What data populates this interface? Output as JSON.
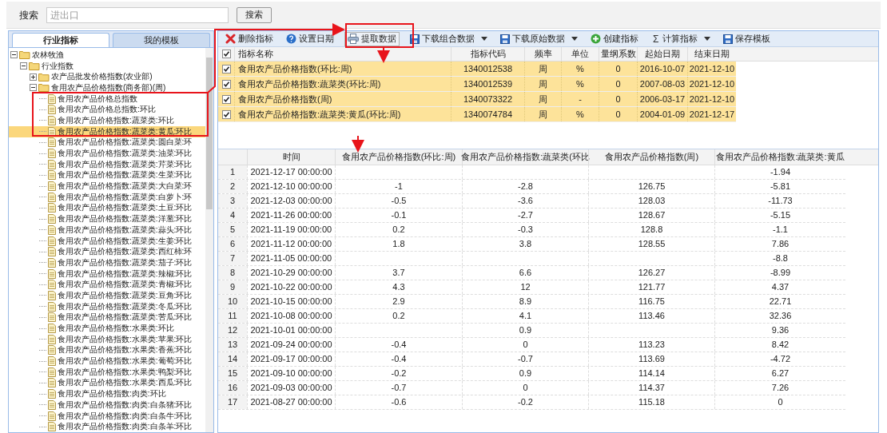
{
  "search": {
    "label": "搜索",
    "placeholder": "进出口",
    "button": "搜索"
  },
  "left_tabs": [
    {
      "label": "行业指标",
      "selected": true
    },
    {
      "label": "我的模板",
      "selected": false
    }
  ],
  "tree": [
    {
      "label": "农林牧渔",
      "expanded": true,
      "selected": false,
      "children": [
        {
          "label": "行业指数",
          "expanded": true,
          "selected": false,
          "children": [
            {
              "label": "农产品批发价格指数(农业部)",
              "expanded": false,
              "selected": false
            },
            {
              "label": "食用农产品价格指数(商务部)(周)",
              "expanded": true,
              "selected": false,
              "children": [
                {
                  "label": "食用农产品价格总指数",
                  "selected": false
                },
                {
                  "label": "食用农产品价格总指数:环比",
                  "selected": false
                },
                {
                  "label": "食用农产品价格指数:蔬菜类:环比",
                  "selected": false
                },
                {
                  "label": "食用农产品价格指数:蔬菜类:黄瓜:环比",
                  "selected": true
                },
                {
                  "label": "食用农产品价格指数:蔬菜类:圆白菜:环",
                  "selected": false
                },
                {
                  "label": "食用农产品价格指数:蔬菜类:油菜:环比",
                  "selected": false
                },
                {
                  "label": "食用农产品价格指数:蔬菜类:芹菜:环比",
                  "selected": false
                },
                {
                  "label": "食用农产品价格指数:蔬菜类:生菜:环比",
                  "selected": false
                },
                {
                  "label": "食用农产品价格指数:蔬菜类:大白菜:环",
                  "selected": false
                },
                {
                  "label": "食用农产品价格指数:蔬菜类:白萝卜:环",
                  "selected": false
                },
                {
                  "label": "食用农产品价格指数:蔬菜类:土豆:环比",
                  "selected": false
                },
                {
                  "label": "食用农产品价格指数:蔬菜类:洋葱:环比",
                  "selected": false
                },
                {
                  "label": "食用农产品价格指数:蔬菜类:蒜头:环比",
                  "selected": false
                },
                {
                  "label": "食用农产品价格指数:蔬菜类:生姜:环比",
                  "selected": false
                },
                {
                  "label": "食用农产品价格指数:蔬菜类:西红柿:环",
                  "selected": false
                },
                {
                  "label": "食用农产品价格指数:蔬菜类:茄子:环比",
                  "selected": false
                },
                {
                  "label": "食用农产品价格指数:蔬菜类:辣椒:环比",
                  "selected": false
                },
                {
                  "label": "食用农产品价格指数:蔬菜类:青椒:环比",
                  "selected": false
                },
                {
                  "label": "食用农产品价格指数:蔬菜类:豆角:环比",
                  "selected": false
                },
                {
                  "label": "食用农产品价格指数:蔬菜类:冬瓜:环比",
                  "selected": false
                },
                {
                  "label": "食用农产品价格指数:蔬菜类:苦瓜:环比",
                  "selected": false
                },
                {
                  "label": "食用农产品价格指数:水果类:环比",
                  "selected": false
                },
                {
                  "label": "食用农产品价格指数:水果类:苹果:环比",
                  "selected": false
                },
                {
                  "label": "食用农产品价格指数:水果类:香蕉:环比",
                  "selected": false
                },
                {
                  "label": "食用农产品价格指数:水果类:葡萄:环比",
                  "selected": false
                },
                {
                  "label": "食用农产品价格指数:水果类:鸭梨:环比",
                  "selected": false
                },
                {
                  "label": "食用农产品价格指数:水果类:西瓜:环比",
                  "selected": false
                },
                {
                  "label": "食用农产品价格指数:肉类:环比",
                  "selected": false
                },
                {
                  "label": "食用农产品价格指数:肉类:白条猪:环比",
                  "selected": false
                },
                {
                  "label": "食用农产品价格指数:肉类:白条牛:环比",
                  "selected": false
                },
                {
                  "label": "食用农产品价格指数:肉类:白条羊:环比",
                  "selected": false
                }
              ]
            }
          ]
        }
      ]
    }
  ],
  "toolbar": [
    {
      "kind": "delete",
      "label": "删除指标",
      "dropdown": false,
      "highlighted": false
    },
    {
      "kind": "help",
      "label": "设置日期",
      "dropdown": false,
      "highlighted": false
    },
    {
      "kind": "print",
      "label": "提取数据",
      "dropdown": false,
      "highlighted": true
    },
    {
      "kind": "save",
      "label": "下载组合数据",
      "dropdown": true,
      "highlighted": false
    },
    {
      "kind": "save",
      "label": "下载原始数据",
      "dropdown": true,
      "highlighted": false
    },
    {
      "kind": "add",
      "label": "创建指标",
      "dropdown": false,
      "highlighted": false
    },
    {
      "kind": "sum",
      "glyph": "Σ",
      "label": "计算指标",
      "dropdown": true,
      "highlighted": false
    },
    {
      "kind": "save",
      "label": "保存模板",
      "dropdown": false,
      "highlighted": false
    }
  ],
  "indicators": {
    "all_checked": true,
    "columns": [
      "指标名称",
      "指标代码",
      "频率",
      "单位",
      "量纲系数",
      "起始日期",
      "结束日期"
    ],
    "rows": [
      {
        "checked": true,
        "selected": true,
        "cells": [
          "食用农产品价格指数(环比:周)",
          "1340012538",
          "周",
          "%",
          "0",
          "2016-10-07",
          "2021-12-10"
        ]
      },
      {
        "checked": true,
        "selected": true,
        "cells": [
          "食用农产品价格指数:蔬菜类(环比:周)",
          "1340012539",
          "周",
          "%",
          "0",
          "2007-08-03",
          "2021-12-10"
        ]
      },
      {
        "checked": true,
        "selected": true,
        "cells": [
          "食用农产品价格指数(周)",
          "1340073322",
          "周",
          "-",
          "0",
          "2006-03-17",
          "2021-12-10"
        ]
      },
      {
        "checked": true,
        "selected": true,
        "cells": [
          "食用农产品价格指数:蔬菜类:黄瓜(环比:周)",
          "1340074784",
          "周",
          "%",
          "0",
          "2004-01-09",
          "2021-12-17"
        ]
      }
    ]
  },
  "data_table": {
    "columns": [
      "时间",
      "食用农产品价格指数(环比:周)",
      "食用农产品价格指数:蔬菜类(环比",
      "食用农产品价格指数(周)",
      "食用农产品价格指数:蔬菜类:黄瓜"
    ],
    "rows": [
      {
        "n": "1",
        "cells": [
          "2021-12-17 00:00:00",
          null,
          null,
          null,
          "-1.94"
        ]
      },
      {
        "n": "2",
        "cells": [
          "2021-12-10 00:00:00",
          "-1",
          "-2.8",
          "126.75",
          "-5.81"
        ]
      },
      {
        "n": "3",
        "cells": [
          "2021-12-03 00:00:00",
          "-0.5",
          "-3.6",
          "128.03",
          "-11.73"
        ]
      },
      {
        "n": "4",
        "cells": [
          "2021-11-26 00:00:00",
          "-0.1",
          "-2.7",
          "128.67",
          "-5.15"
        ]
      },
      {
        "n": "5",
        "cells": [
          "2021-11-19 00:00:00",
          "0.2",
          "-0.3",
          "128.8",
          "-1.1"
        ]
      },
      {
        "n": "6",
        "cells": [
          "2021-11-12 00:00:00",
          "1.8",
          "3.8",
          "128.55",
          "7.86"
        ]
      },
      {
        "n": "7",
        "cells": [
          "2021-11-05 00:00:00",
          null,
          null,
          null,
          "-8.8"
        ]
      },
      {
        "n": "8",
        "cells": [
          "2021-10-29 00:00:00",
          "3.7",
          "6.6",
          "126.27",
          "-8.99"
        ]
      },
      {
        "n": "9",
        "cells": [
          "2021-10-22 00:00:00",
          "4.3",
          "12",
          "121.77",
          "4.37"
        ]
      },
      {
        "n": "10",
        "cells": [
          "2021-10-15 00:00:00",
          "2.9",
          "8.9",
          "116.75",
          "22.71"
        ]
      },
      {
        "n": "11",
        "cells": [
          "2021-10-08 00:00:00",
          "0.2",
          "4.1",
          "113.46",
          "32.36"
        ]
      },
      {
        "n": "12",
        "cells": [
          "2021-10-01 00:00:00",
          null,
          "0.9",
          null,
          "9.36"
        ]
      },
      {
        "n": "13",
        "cells": [
          "2021-09-24 00:00:00",
          "-0.4",
          "0",
          "113.23",
          "8.42"
        ]
      },
      {
        "n": "14",
        "cells": [
          "2021-09-17 00:00:00",
          "-0.4",
          "-0.7",
          "113.69",
          "-4.72"
        ]
      },
      {
        "n": "15",
        "cells": [
          "2021-09-10 00:00:00",
          "-0.2",
          "0.9",
          "114.14",
          "6.27"
        ]
      },
      {
        "n": "16",
        "cells": [
          "2021-09-03 00:00:00",
          "-0.7",
          "0",
          "114.37",
          "7.26"
        ]
      },
      {
        "n": "17",
        "cells": [
          "2021-08-27 00:00:00",
          "-0.6",
          "-0.2",
          "115.18",
          "0"
        ]
      }
    ]
  }
}
